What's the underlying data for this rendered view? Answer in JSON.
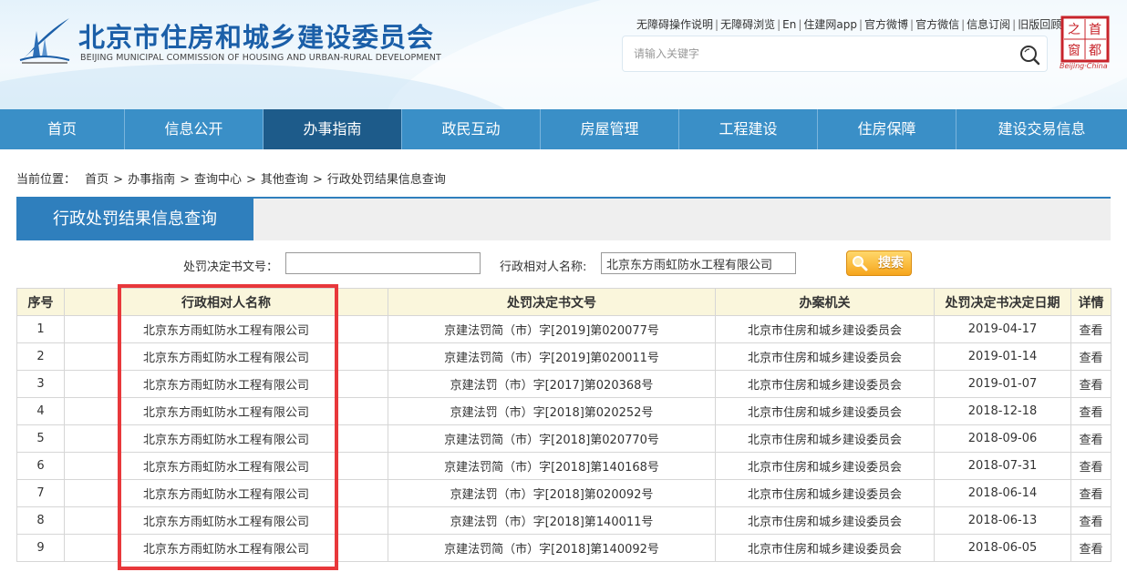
{
  "header": {
    "title": "北京市住房和城乡建设委员会",
    "subtitle": "BEIJING MUNICIPAL COMMISSION OF HOUSING AND URBAN-RURAL DEVELOPMENT",
    "top_links": [
      "无障碍操作说明",
      "无障碍浏览",
      "En",
      "住建网app",
      "官方微博",
      "官方微信",
      "信息订阅",
      "旧版回顾"
    ],
    "search_placeholder": "请输入关键字",
    "seal_chars": [
      "首",
      "都",
      "之",
      "窗"
    ],
    "seal_caption": "Beijing·China"
  },
  "nav": {
    "items": [
      "首页",
      "信息公开",
      "办事指南",
      "政民互动",
      "房屋管理",
      "工程建设",
      "住房保障",
      "建设交易信息"
    ],
    "active_index": 2
  },
  "breadcrumb": {
    "prefix": "当前位置：",
    "items": [
      "首页",
      "办事指南",
      "查询中心",
      "其他查询",
      "行政处罚结果信息查询"
    ],
    "separator": ">"
  },
  "section": {
    "title": "行政处罚结果信息查询"
  },
  "form": {
    "doc_no_label": "处罚决定书文号：",
    "doc_no_value": "",
    "party_label": "行政相对人名称:",
    "party_value": "北京东方雨虹防水工程有限公司",
    "search_button": "搜索"
  },
  "table": {
    "headers": [
      "序号",
      "行政相对人名称",
      "处罚决定书文号",
      "办案机关",
      "处罚决定书决定日期",
      "详情"
    ],
    "rows": [
      [
        "1",
        "北京东方雨虹防水工程有限公司",
        "京建法罚简（市）字[2019]第020077号",
        "北京市住房和城乡建设委员会",
        "2019-04-17",
        "查看"
      ],
      [
        "2",
        "北京东方雨虹防水工程有限公司",
        "京建法罚简（市）字[2019]第020011号",
        "北京市住房和城乡建设委员会",
        "2019-01-14",
        "查看"
      ],
      [
        "3",
        "北京东方雨虹防水工程有限公司",
        "京建法罚（市）字[2017]第020368号",
        "北京市住房和城乡建设委员会",
        "2019-01-07",
        "查看"
      ],
      [
        "4",
        "北京东方雨虹防水工程有限公司",
        "京建法罚（市）字[2018]第020252号",
        "北京市住房和城乡建设委员会",
        "2018-12-18",
        "查看"
      ],
      [
        "5",
        "北京东方雨虹防水工程有限公司",
        "京建法罚简（市）字[2018]第020770号",
        "北京市住房和城乡建设委员会",
        "2018-09-06",
        "查看"
      ],
      [
        "6",
        "北京东方雨虹防水工程有限公司",
        "京建法罚简（市）字[2018]第140168号",
        "北京市住房和城乡建设委员会",
        "2018-07-31",
        "查看"
      ],
      [
        "7",
        "北京东方雨虹防水工程有限公司",
        "京建法罚（市）字[2018]第020092号",
        "北京市住房和城乡建设委员会",
        "2018-06-14",
        "查看"
      ],
      [
        "8",
        "北京东方雨虹防水工程有限公司",
        "京建法罚（市）字[2018]第140011号",
        "北京市住房和城乡建设委员会",
        "2018-06-13",
        "查看"
      ],
      [
        "9",
        "北京东方雨虹防水工程有限公司",
        "京建法罚简（市）字[2018]第140092号",
        "北京市住房和城乡建设委员会",
        "2018-06-05",
        "查看"
      ]
    ]
  },
  "colors": {
    "brand_blue": "#1b5fa8",
    "nav_bg": "#3a8fc7",
    "nav_active": "#1d5b8a",
    "section_tab": "#2f7fbd",
    "table_header_bg": "#faf6dc",
    "highlight_red": "#e8383b",
    "button_orange": "#f6a51c"
  },
  "icons": {
    "logo": "commission-emblem-icon",
    "search": "search-icon",
    "seal": "capital-window-seal-icon",
    "search_button": "magnifier-icon"
  }
}
